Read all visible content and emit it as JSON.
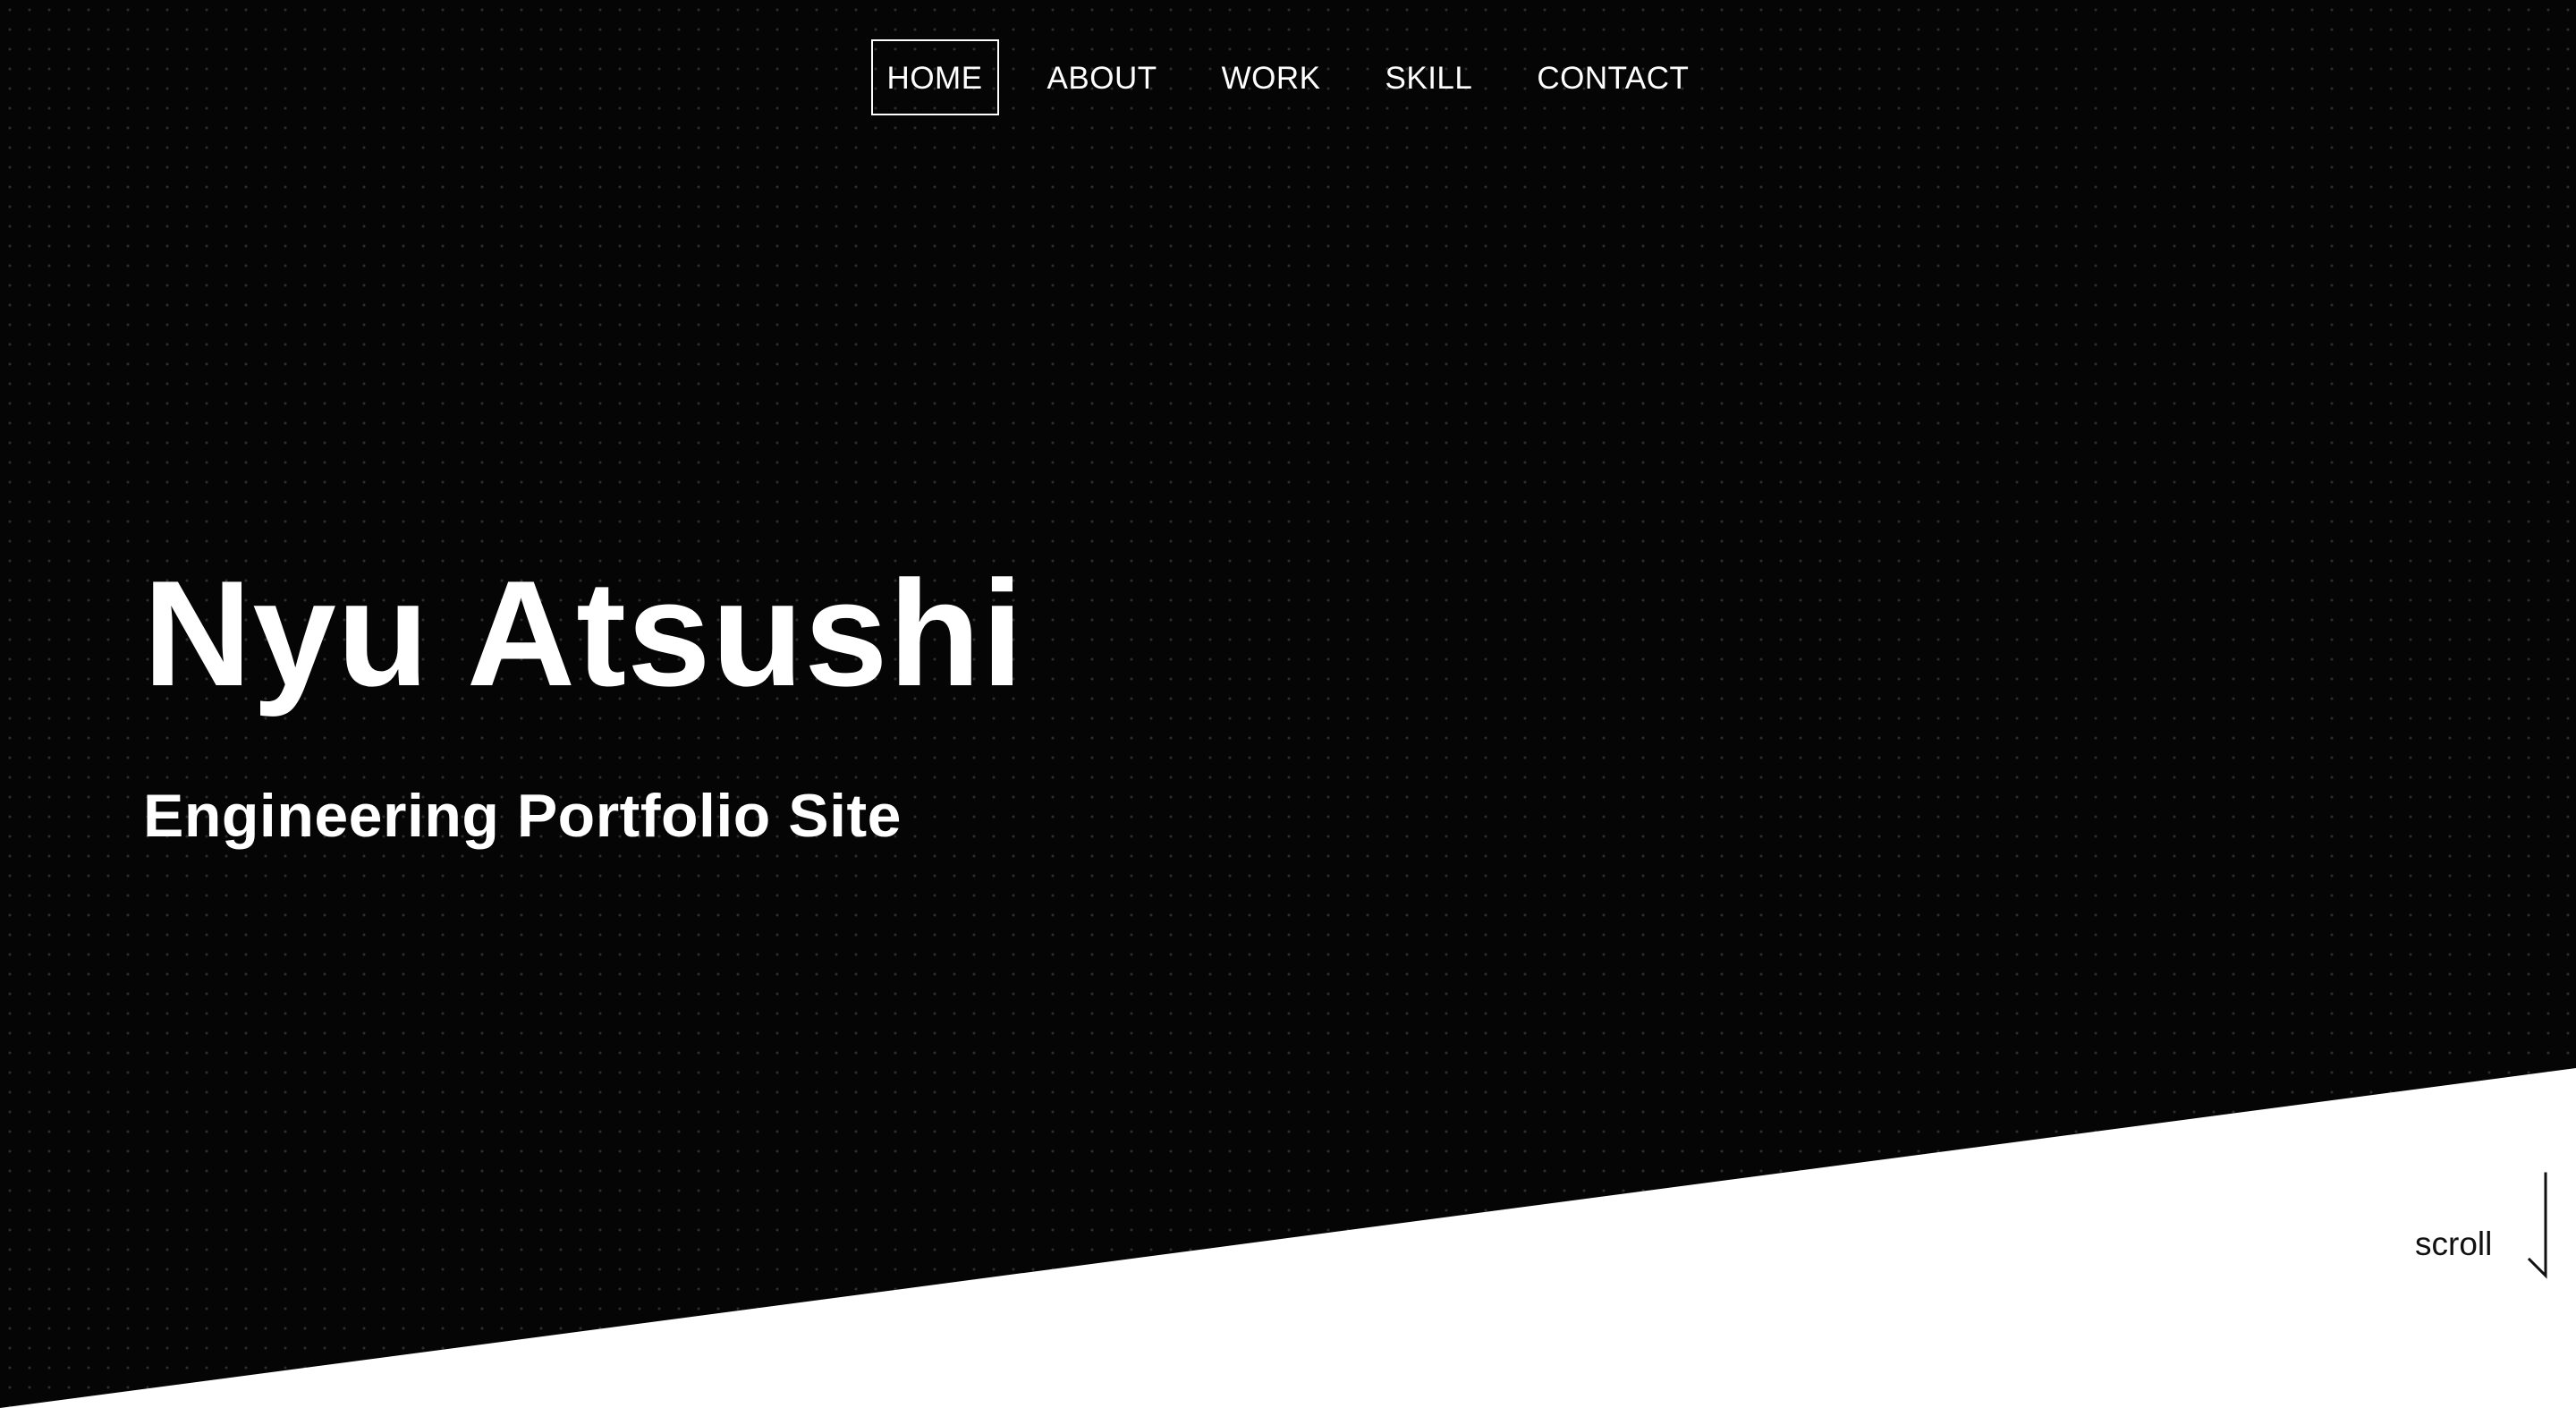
{
  "nav": {
    "items": [
      {
        "label": "HOME",
        "active": true
      },
      {
        "label": "ABOUT",
        "active": false
      },
      {
        "label": "WORK",
        "active": false
      },
      {
        "label": "SKILL",
        "active": false
      },
      {
        "label": "CONTACT",
        "active": false
      }
    ]
  },
  "hero": {
    "title": "Nyu Atsushi",
    "subtitle": "Engineering Portfolio Site",
    "background_color": "#050505",
    "text_color": "#ffffff"
  },
  "scroll": {
    "label": "scroll",
    "icon": "arrow-down-icon"
  }
}
